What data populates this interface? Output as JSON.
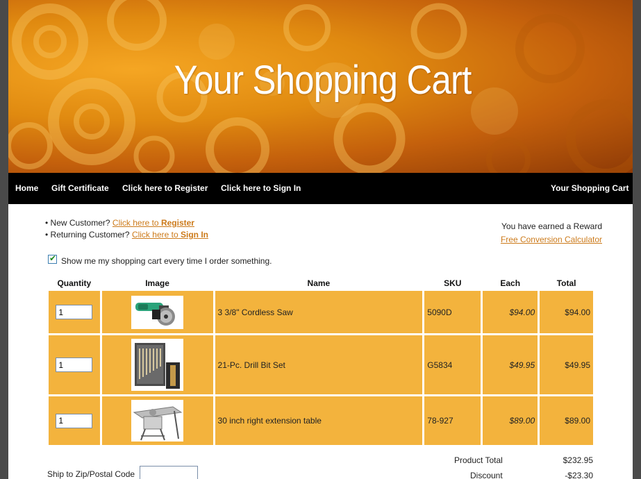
{
  "banner": {
    "title": "Your Shopping Cart"
  },
  "nav": {
    "home": "Home",
    "gift_certificate": "Gift Certificate",
    "register": "Click here to Register",
    "sign_in": "Click here to Sign In",
    "cart": "Your Shopping Cart"
  },
  "customer": {
    "new_prefix": "• New Customer?",
    "new_link_text": "Click here to",
    "new_link_bold": "Register",
    "returning_prefix": "• Returning Customer?",
    "returning_link_text": "Click here to",
    "returning_link_bold": "Sign In"
  },
  "reward": {
    "text": "You have earned a Reward",
    "link": "Free Conversion Calculator"
  },
  "show_cart_option": {
    "label": "Show me my shopping cart every time I order something.",
    "checked": true
  },
  "table": {
    "headers": [
      "Quantity",
      "Image",
      "Name",
      "SKU",
      "Each",
      "Total"
    ],
    "rows": [
      {
        "qty": "1",
        "image": "cordless-saw-image",
        "name": "3 3/8\" Cordless Saw",
        "sku": "5090D",
        "each": "$94.00",
        "total": "$94.00"
      },
      {
        "qty": "1",
        "image": "drill-bit-set-image",
        "name": "21-Pc. Drill Bit Set",
        "sku": "G5834",
        "each": "$49.95",
        "total": "$49.95"
      },
      {
        "qty": "1",
        "image": "extension-table-image",
        "name": "30 inch right extension table",
        "sku": "78-927",
        "each": "$89.00",
        "total": "$89.00"
      }
    ]
  },
  "summary": {
    "product_total_label": "Product Total",
    "product_total": "$232.95",
    "discount_label": "Discount",
    "discount": "-$23.30",
    "zip_label": "Ship to Zip/Postal Code"
  },
  "colors": {
    "accent": "#f3b33d",
    "link": "#cc7a1a",
    "nav_bg": "#000000"
  }
}
